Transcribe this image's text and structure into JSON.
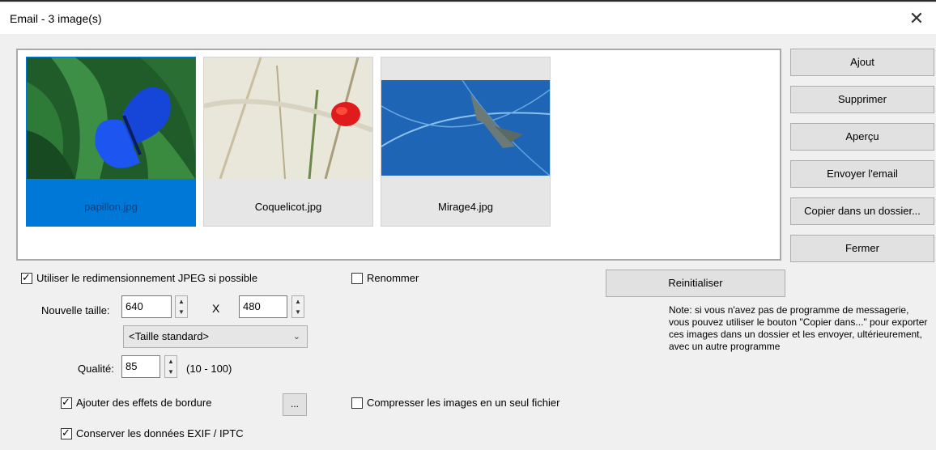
{
  "window": {
    "title": "Email - 3 image(s)",
    "close_glyph": "✕"
  },
  "thumbnails": [
    {
      "filename": "papillon.jpg",
      "selected": true
    },
    {
      "filename": "Coquelicot.jpg",
      "selected": false
    },
    {
      "filename": "Mirage4.jpg",
      "selected": false
    }
  ],
  "buttons": {
    "ajout": "Ajout",
    "supprimer": "Supprimer",
    "apercu": "Aperçu",
    "envoyer": "Envoyer l'email",
    "copier": "Copier dans un dossier...",
    "fermer": "Fermer",
    "reinitialiser": "Reinitialiser",
    "border_options": "..."
  },
  "resize": {
    "checkbox_label": "Utiliser le redimensionnement JPEG si possible",
    "checked": true,
    "size_label": "Nouvelle taille:",
    "width": "640",
    "x_label": "X",
    "height": "480",
    "preset": "<Taille standard>",
    "quality_label": "Qualité:",
    "quality": "85",
    "quality_range": "(10 - 100)"
  },
  "rename": {
    "label": "Renommer",
    "checked": false
  },
  "border": {
    "label": "Ajouter des effets de bordure",
    "checked": true
  },
  "exif": {
    "label": "Conserver les données EXIF / IPTC",
    "checked": true
  },
  "compress": {
    "label": "Compresser les images en un seul fichier",
    "checked": false
  },
  "note": "Note: si vous n'avez pas de programme de messagerie, vous pouvez utiliser le bouton \"Copier dans...\" pour exporter ces images dans un dossier et les envoyer, ultérieurement, avec un autre programme"
}
